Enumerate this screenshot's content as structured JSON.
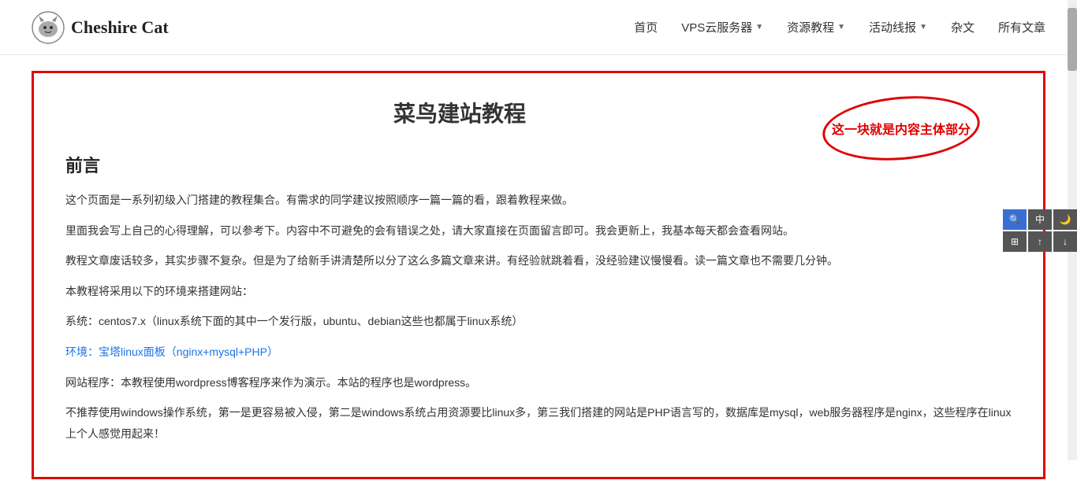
{
  "header": {
    "logo_text": "Cheshire Cat",
    "nav_items": [
      {
        "label": "首页",
        "has_arrow": false
      },
      {
        "label": "VPS云服务器",
        "has_arrow": true
      },
      {
        "label": "资源教程",
        "has_arrow": true
      },
      {
        "label": "活动线报",
        "has_arrow": true
      },
      {
        "label": "杂文",
        "has_arrow": false
      },
      {
        "label": "所有文章",
        "has_arrow": false
      }
    ]
  },
  "article": {
    "title": "菜鸟建站教程",
    "annotation": "这一块就是内容主体部分",
    "section": "前言",
    "paragraphs": [
      "这个页面是一系列初级入门搭建的教程集合。有需求的同学建议按照顺序一篇一篇的看，跟着教程来做。",
      "里面我会写上自己的心得理解，可以参考下。内容中不可避免的会有错误之处，请大家直接在页面留言即可。我会更新上，我基本每天都会查看网站。",
      "教程文章废话较多，其实步骤不复杂。但是为了给新手讲清楚所以分了这么多篇文章来讲。有经验就跳着看，没经验建议慢慢看。读一篇文章也不需要几分钟。",
      "本教程将采用以下的环境来搭建网站：",
      "系统：centos7.x（linux系统下面的其中一个发行版，ubuntu、debian这些也都属于linux系统）",
      "环境：宝塔linux面板（nginx+mysql+PHP）",
      "网站程序：本教程使用wordpress博客程序来作为演示。本站的程序也是wordpress。",
      "不推荐使用windows操作系统，第一是更容易被入侵，第二是windows系统占用资源要比linux多，第三我们搭建的网站是PHP语言写的，数据库是mysql，web服务器程序是nginx，这些程序在linux上个人感觉用起来！"
    ]
  },
  "toolbar": {
    "buttons": [
      "中",
      "🌙",
      "⊙",
      "⊞",
      "↑",
      "↓"
    ]
  }
}
